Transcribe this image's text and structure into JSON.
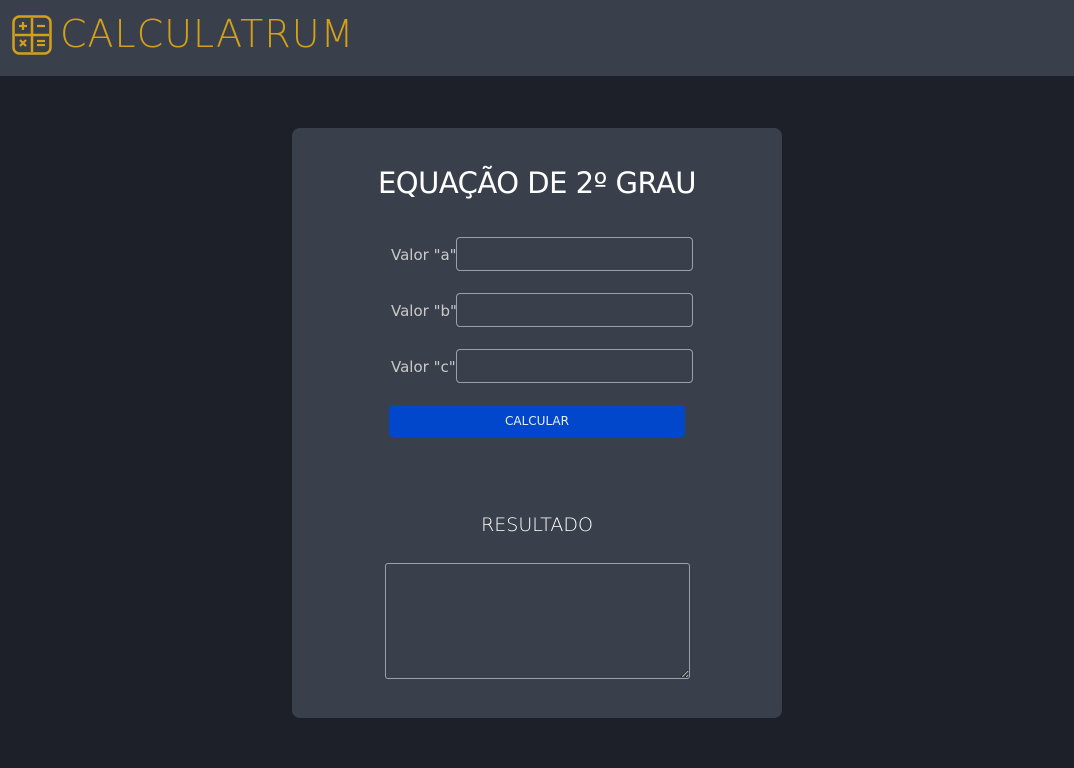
{
  "header": {
    "brand": "CALCULATRUM",
    "logo_icon": "calculator-icon",
    "brand_color": "#d4a017",
    "background": "#3a404b"
  },
  "card": {
    "title": "EQUAÇÃO DE 2º GRAU",
    "fields": [
      {
        "label": "Valor \"a\"",
        "value": "",
        "placeholder": ""
      },
      {
        "label": "Valor \"b\"",
        "value": "",
        "placeholder": ""
      },
      {
        "label": "Valor \"c\"",
        "value": "",
        "placeholder": ""
      }
    ],
    "button_label": "CALCULAR",
    "button_color": "#0047cc",
    "result_title": "RESULTADO",
    "result_value": ""
  },
  "page_background": "#1e2029"
}
